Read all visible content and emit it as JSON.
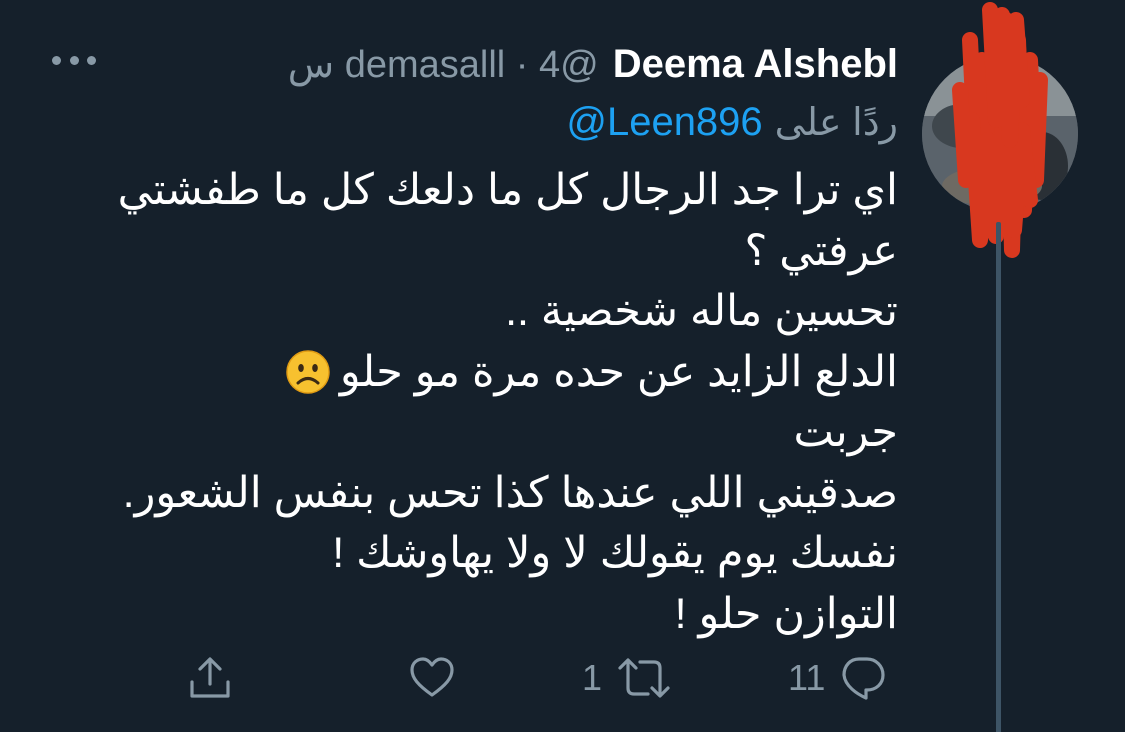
{
  "tweet": {
    "display_name": "Deema Alshebl",
    "meta": "@demasalll · 4 س",
    "reply_prefix": "ردًا على",
    "reply_handle": "@Leen896",
    "body_lines": [
      "اي ترا جد الرجال كل ما دلعك كل ما طفشتي",
      "عرفتي ؟",
      "تحسين ماله شخصية ..",
      "الدلع الزايد عن حده مرة مو حلو",
      "جربت",
      "صدقيني اللي عندها كذا تحس بنفس الشعور.",
      "نفسك يوم يقولك لا ولا يهاوشك !",
      "التوازن حلو !"
    ],
    "emoji": "frowning-face-emoji"
  },
  "actions": {
    "reply_count": "11",
    "retweet_count": "1",
    "like_count": "",
    "share_count": ""
  },
  "icons": {
    "more": "more-horizontal-icon",
    "reply": "reply-bubble-icon",
    "retweet": "retweet-icon",
    "like": "heart-icon",
    "share": "share-icon"
  },
  "colors": {
    "background": "#15202b",
    "text": "#ffffff",
    "muted": "#8899a6",
    "link": "#1da1f2",
    "thread_line": "#3d5466",
    "redaction": "#d8381f"
  }
}
